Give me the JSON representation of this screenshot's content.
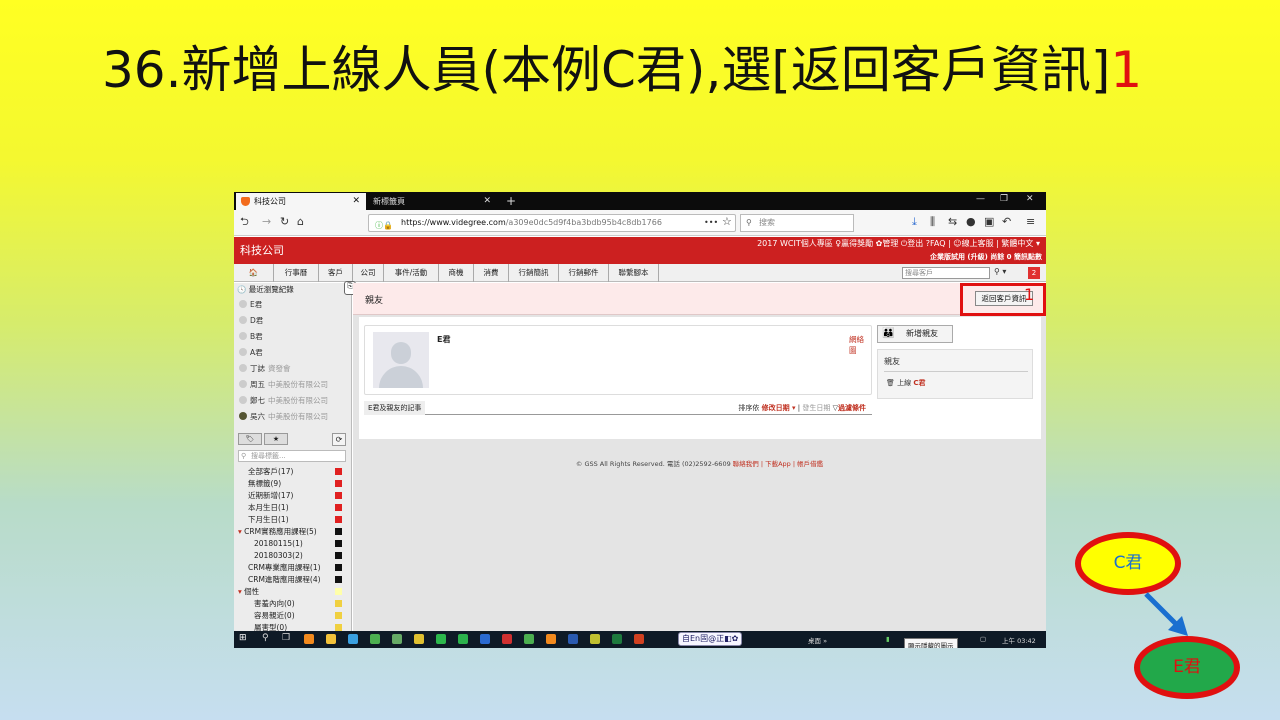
{
  "slide": {
    "title_main": "36.新增上線人員(本例C君),選[返回客戶資訊]",
    "title_num": "1"
  },
  "browser": {
    "tab_active": "科技公司",
    "tab_inactive": "新標籤頁",
    "url_host": "https://www.videgree.com",
    "url_path": "/a309e0dc5d9f4ba3bdb95b4c8db1766",
    "search_placeholder": "搜索",
    "menu_dots": "•••"
  },
  "app": {
    "brand": "科技公司",
    "top_menu": "2017 WCIT個人專區  ♀贏得獎勵  ✿管理  ⏻登出  ?FAQ  |  ☺線上客服  |  繁體中文 ▾",
    "top_sub": "企業版試用 (升級)  尚餘 0 簡訊點數",
    "nav": [
      "行事曆",
      "客戶",
      "公司",
      "事件/活動",
      "商機",
      "消費",
      "行銷簡訊",
      "行銷郵件",
      "聯繫腳本"
    ],
    "customer_search_placeholder": "搜尋客戶",
    "badge": "2"
  },
  "sidebar": {
    "recent_title": "最近瀏覽紀錄",
    "recent": [
      {
        "name": "E君",
        "company": ""
      },
      {
        "name": "D君",
        "company": ""
      },
      {
        "name": "B君",
        "company": ""
      },
      {
        "name": "A君",
        "company": ""
      },
      {
        "name": "丁誌",
        "company": "資發會"
      },
      {
        "name": "周五",
        "company": "中美股份有限公司"
      },
      {
        "name": "鄭七",
        "company": "中美股份有限公司"
      },
      {
        "name": "吳六",
        "company": "中美股份有限公司"
      }
    ],
    "tag_search_placeholder": "搜尋標籤...",
    "tags": [
      {
        "label": "全部客戶(17)",
        "color": "#e02020",
        "indent": 0
      },
      {
        "label": "無標籤(9)",
        "color": "#e02020",
        "indent": 0
      },
      {
        "label": "近期新增(17)",
        "color": "#e02020",
        "indent": 0
      },
      {
        "label": "本月生日(1)",
        "color": "#e02020",
        "indent": 0
      },
      {
        "label": "下月生日(1)",
        "color": "#e02020",
        "indent": 0
      },
      {
        "label": "CRM實務應用課程(5)",
        "color": "#111111",
        "indent": 0,
        "expand": true
      },
      {
        "label": "20180115(1)",
        "color": "#111111",
        "indent": 1
      },
      {
        "label": "20180303(2)",
        "color": "#111111",
        "indent": 1
      },
      {
        "label": "CRM專業應用課程(1)",
        "color": "#111111",
        "indent": 0
      },
      {
        "label": "CRM進階應用課程(4)",
        "color": "#111111",
        "indent": 0
      },
      {
        "label": "個性",
        "color": "#ffffaa",
        "indent": 0,
        "expand": true
      },
      {
        "label": "害羞內向(0)",
        "color": "#f0d040",
        "indent": 1
      },
      {
        "label": "容易親近(0)",
        "color": "#f0d040",
        "indent": 1
      },
      {
        "label": "屬害型(0)",
        "color": "#f0d040",
        "indent": 1
      }
    ]
  },
  "main": {
    "crumb": "親友",
    "back_button": "返回客戶資訊",
    "highlight_num": "1",
    "card_name": "E君",
    "card_link": "網絡圖",
    "add_friend": "新增親友",
    "friend_title": "親友",
    "friend_item_prefix": "上線",
    "friend_item_name": "C君",
    "notes_title": "E君及親友的記事",
    "sort_label": "排序依",
    "sort_active": "修改日期 ▾",
    "sort_sep": " | ",
    "sort_alt": "發生日期",
    "filter": "過濾條件",
    "footer_text": "© GSS All Rights Reserved. 電話 (02)2592-6609 ",
    "footer_links": "聯絡我們 | 下載App | 帳戶借鑑"
  },
  "taskbar": {
    "ime": "自En固@正◧✿",
    "desktop": "桌面 »",
    "tooltip": "顯示隱藏的圖示",
    "time": "上午 03:42"
  },
  "diagram": {
    "node_c": "C君",
    "node_e": "E君"
  }
}
